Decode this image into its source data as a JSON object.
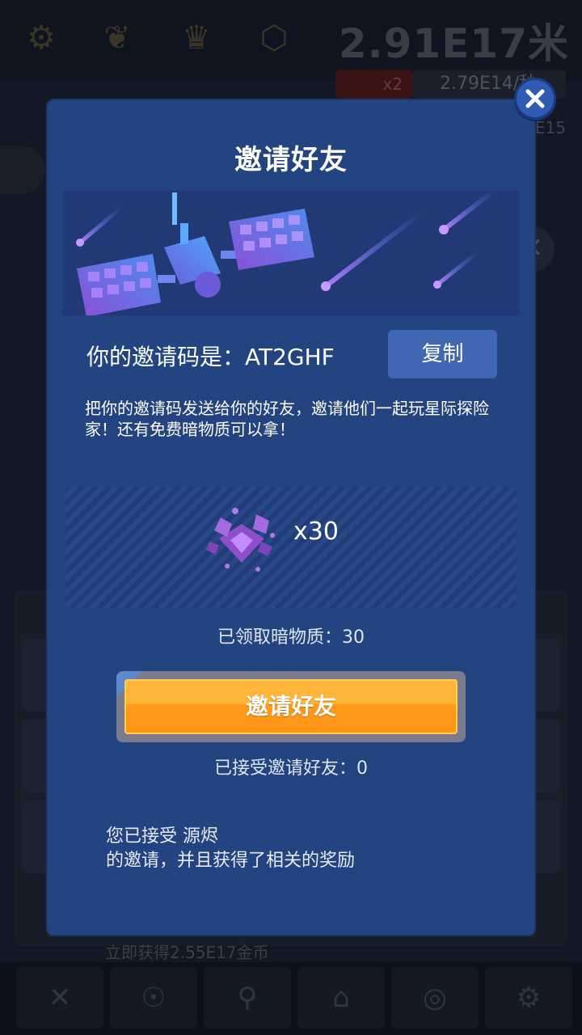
{
  "background": {
    "distance": "2.91E17米",
    "multiplier": "x2",
    "rate": "2.79E14/秒",
    "rate2": "E15",
    "bottom_text": "立即获得2.55E17金币"
  },
  "dialog": {
    "title": "邀请好友",
    "code_label": "你的邀请码是：AT2GHF",
    "copy_label": "复制",
    "description": "把你的邀请码发送给你的好友，邀请他们一起玩星际探险家！还有免费暗物质可以拿！",
    "reward_count": "x30",
    "claimed_text": "已领取暗物质：30",
    "invite_button": "邀请好友",
    "accepted_text": "已接受邀请好友：0",
    "inviter_line1": "您已接受 源烬",
    "inviter_line2": "的邀请，并且获得了相关的奖励"
  },
  "icons": [
    "close-icon",
    "satellite-icon",
    "meteor-icon",
    "dark-matter-icon",
    "gear-icon",
    "crown-icon",
    "trophy-icon"
  ],
  "colors": {
    "dialog_bg": "#244381",
    "copy_button": "#4166b2",
    "invite_button": "#ffa526",
    "close_button": "#2f5bb3"
  }
}
